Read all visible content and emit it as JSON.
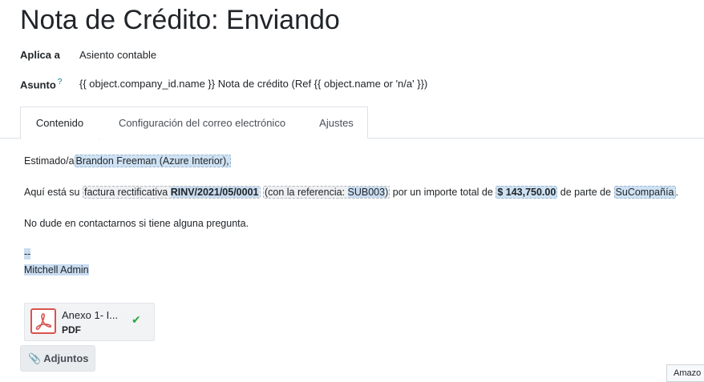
{
  "header": {
    "title": "Nota de Crédito: Enviando"
  },
  "fields": {
    "applies_label": "Aplica a",
    "applies_value": "Asiento contable",
    "subject_label": "Asunto",
    "subject_help": "?",
    "subject_value": "{{ object.company_id.name }} Nota de crédito (Ref {{ object.name or 'n/a' }})"
  },
  "tabs": [
    {
      "label": "Contenido",
      "active": true
    },
    {
      "label": "Configuración del correo electrónico",
      "active": false
    },
    {
      "label": "Ajustes",
      "active": false
    }
  ],
  "content": {
    "greeting_prefix": "Estimado/a",
    "partner": "Brandon Freeman (Azure Interior),",
    "p2_prefix": "Aquí está su",
    "doc_type": "factura rectificativa",
    "doc_number": "RINV/2021/05/0001",
    "ref_prefix": "(con la referencia:",
    "ref_value": "SUB003",
    "ref_suffix": ")",
    "amount_prefix": "por un importe total de",
    "amount": "$ 143,750.00",
    "from_prefix": "de parte de",
    "company": "SuCompañía",
    "end_dot": ".",
    "contact_line": "No dude en contactarnos si tiene alguna pregunta.",
    "signature_sep": "--",
    "signature_name": "Mitchell Admin"
  },
  "attachment": {
    "name": "Anexo 1- I...",
    "type": "PDF",
    "icon": "pdf-icon",
    "status_icon": "check-icon"
  },
  "attach_button": {
    "label": "Adjuntos",
    "icon": "paperclip-icon"
  },
  "corner_tab": {
    "label": "Amazo"
  },
  "colors": {
    "accent": "#017e84",
    "check": "#28a745",
    "pdf": "#d9534f",
    "placeholder": "#cfe2f3"
  }
}
